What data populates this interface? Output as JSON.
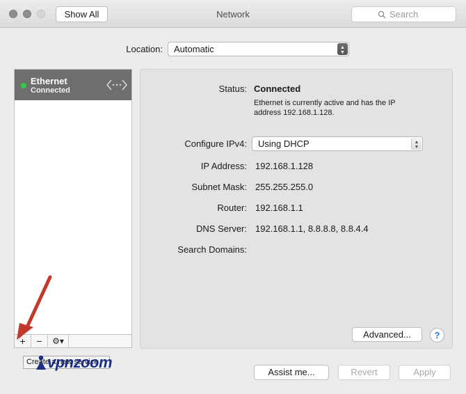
{
  "window": {
    "title": "Network"
  },
  "toolbar": {
    "show_all_label": "Show All",
    "search_placeholder": "Search"
  },
  "location": {
    "label": "Location:",
    "value": "Automatic"
  },
  "services": [
    {
      "name": "Ethernet",
      "status": "Connected",
      "status_color": "#2ecc40"
    }
  ],
  "sidebar_toolbar": {
    "add": "+",
    "remove": "−",
    "gear": "⚙▾"
  },
  "tooltip": {
    "text": "Create a new service"
  },
  "watermark": {
    "text": "vpnzoom"
  },
  "details": {
    "status_label": "Status:",
    "status_value": "Connected",
    "status_desc_line1": "Ethernet is currently active and has the IP",
    "status_desc_line2": "address 192.168.1.128.",
    "configure_label": "Configure IPv4:",
    "configure_value": "Using DHCP",
    "ip_label": "IP Address:",
    "ip_value": "192.168.1.128",
    "subnet_label": "Subnet Mask:",
    "subnet_value": "255.255.255.0",
    "router_label": "Router:",
    "router_value": "192.168.1.1",
    "dns_label": "DNS Server:",
    "dns_value": "192.168.1.1, 8.8.8.8, 8.8.4.4",
    "search_domains_label": "Search Domains:",
    "advanced_label": "Advanced...",
    "help_label": "?"
  },
  "footer": {
    "assist_label": "Assist me...",
    "revert_label": "Revert",
    "apply_label": "Apply"
  },
  "colors": {
    "annotation_arrow": "#c0392b",
    "selected_row": "#6e6e6e",
    "logo": "#1c2f82"
  }
}
